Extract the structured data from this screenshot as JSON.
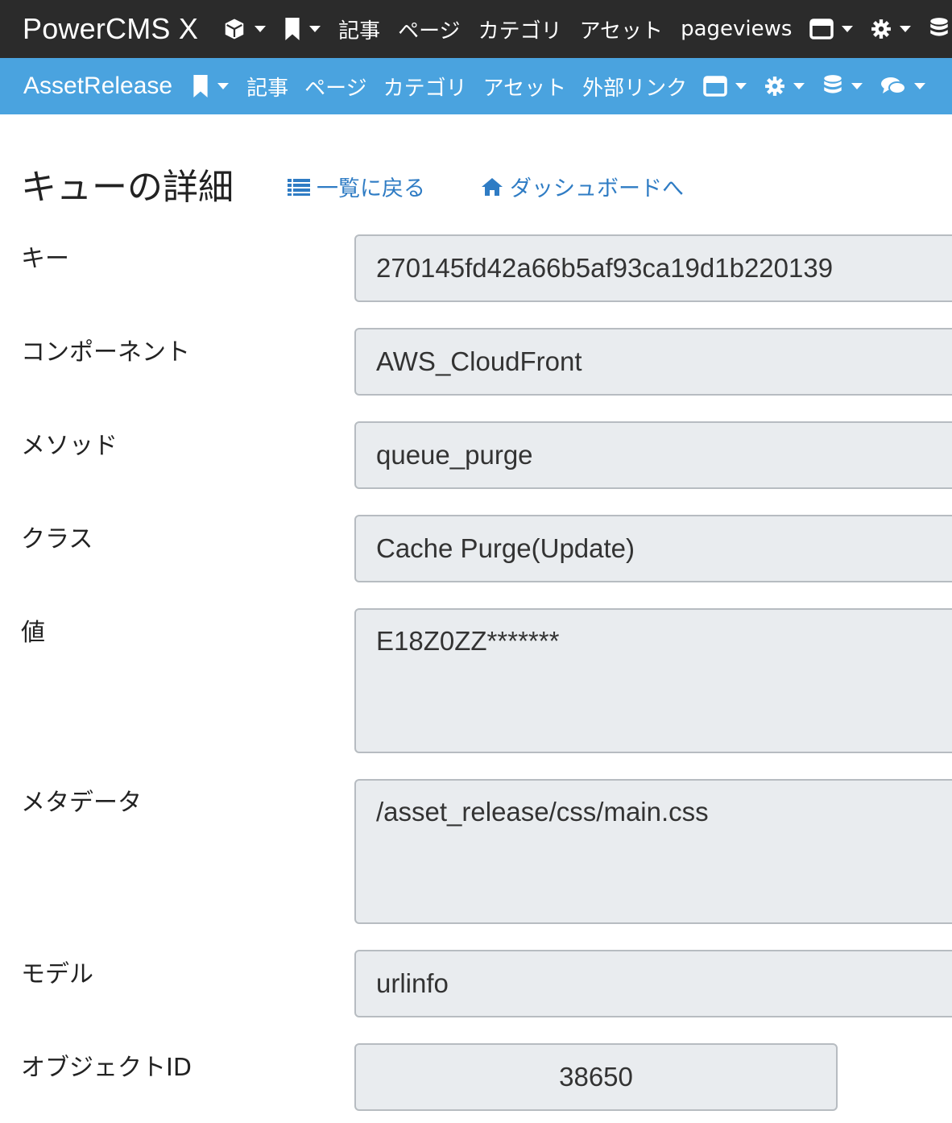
{
  "topbar": {
    "brand": "PowerCMS X",
    "items": [
      "記事",
      "ページ",
      "カテゴリ",
      "アセット",
      "pageviews"
    ],
    "icons": [
      "cube-icon",
      "bookmark-icon",
      "window-icon",
      "gear-icon",
      "database-icon"
    ]
  },
  "subbar": {
    "brand": "AssetRelease",
    "items": [
      "記事",
      "ページ",
      "カテゴリ",
      "アセット",
      "外部リンク"
    ],
    "icons": [
      "bookmark-icon",
      "window-icon",
      "gear-icon",
      "database-icon",
      "comments-icon"
    ]
  },
  "page": {
    "title": "キューの詳細",
    "back_link": "一覧に戻る",
    "dashboard_link": "ダッシュボードへ"
  },
  "fields": {
    "key": {
      "label": "キー",
      "value": "270145fd42a66b5af93ca19d1b220139"
    },
    "component": {
      "label": "コンポーネント",
      "value": "AWS_CloudFront"
    },
    "method": {
      "label": "メソッド",
      "value": "queue_purge"
    },
    "class": {
      "label": "クラス",
      "value": "Cache Purge(Update)"
    },
    "value": {
      "label": "値",
      "value": "E18Z0ZZ*******"
    },
    "metadata": {
      "label": "メタデータ",
      "value": "/asset_release/css/main.css"
    },
    "model": {
      "label": "モデル",
      "value": "urlinfo"
    },
    "object_id": {
      "label": "オブジェクトID",
      "value": "38650"
    }
  },
  "colors": {
    "topbar_bg": "#2b2b2b",
    "subbar_bg": "#4aa3df",
    "link": "#2f7cc4",
    "field_bg": "#e9ecef"
  }
}
